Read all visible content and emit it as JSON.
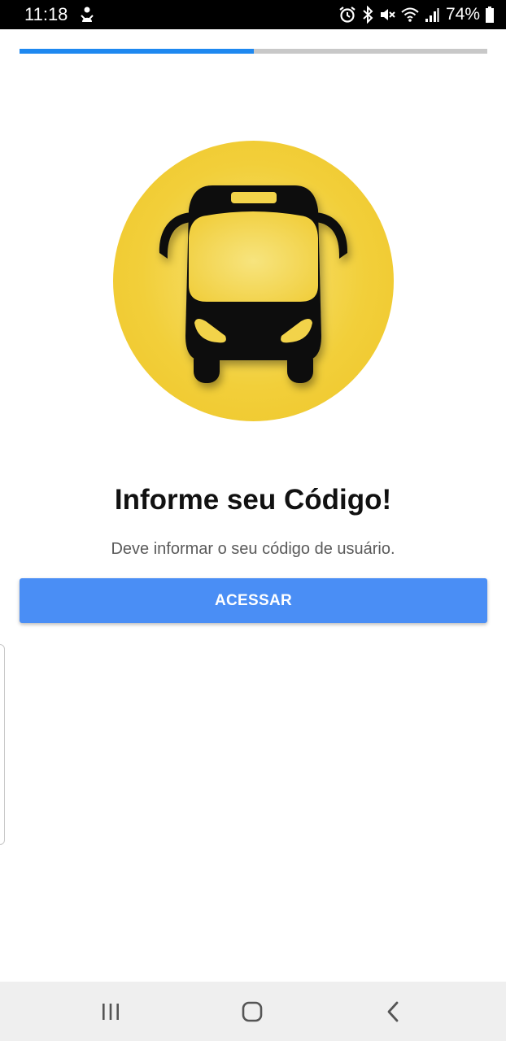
{
  "status_bar": {
    "time": "11:18",
    "battery": "74%",
    "icons": [
      "notification-person-icon",
      "alarm-icon",
      "bluetooth-icon",
      "mute-icon",
      "wifi-icon",
      "signal-icon",
      "battery-icon"
    ]
  },
  "progress": {
    "value": 0.5,
    "fill_color": "#1e88f0",
    "track_color": "#c8c8c8"
  },
  "hero": {
    "icon": "bus-icon",
    "circle_color": "#f2cf3a"
  },
  "content": {
    "title": "Informe seu Código!",
    "subtitle": "Deve informar o seu código de usuário.",
    "button_label": "ACESSAR",
    "button_color": "#4a8ef5"
  },
  "nav_bar": {
    "buttons": [
      "recent-apps-icon",
      "home-icon",
      "back-icon"
    ]
  }
}
